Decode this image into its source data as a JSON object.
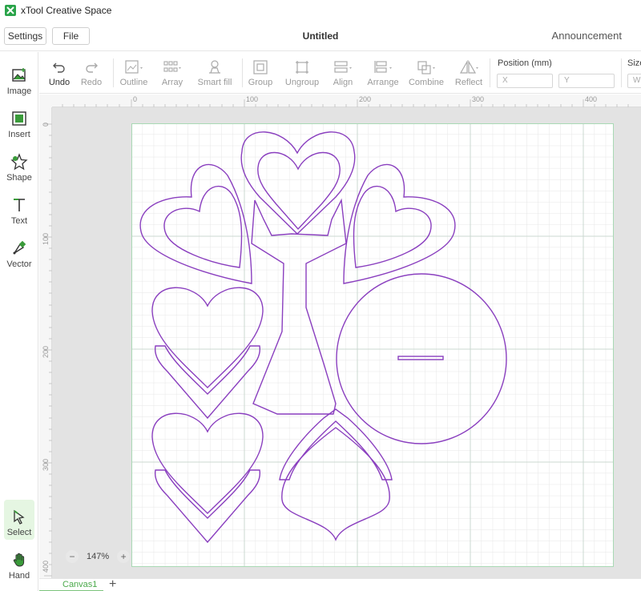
{
  "app": {
    "title": "xTool Creative Space",
    "logo_icon": "xtool-logo-icon",
    "accent": "#2aa44a"
  },
  "menubar": {
    "settings_label": "Settings",
    "file_label": "File",
    "document_title": "Untitled",
    "announcement_label": "Announcement"
  },
  "sidebar": {
    "items": [
      {
        "label": "Image",
        "icon": "image-icon"
      },
      {
        "label": "Insert",
        "icon": "insert-icon"
      },
      {
        "label": "Shape",
        "icon": "shape-icon"
      },
      {
        "label": "Text",
        "icon": "text-icon"
      },
      {
        "label": "Vector",
        "icon": "vector-icon"
      },
      {
        "label": "Select",
        "icon": "select-icon",
        "active": true
      },
      {
        "label": "Hand",
        "icon": "hand-icon"
      }
    ]
  },
  "toolbar": {
    "undo": "Undo",
    "redo": "Redo",
    "outline": "Outline",
    "array": "Array",
    "smart_fill": "Smart fill",
    "group": "Group",
    "ungroup": "Ungroup",
    "align": "Align",
    "arrange": "Arrange",
    "combine": "Combine",
    "reflect": "Reflect",
    "position_label": "Position (mm)",
    "x_placeholder": "X",
    "y_placeholder": "Y",
    "size_label": "Size",
    "w_placeholder": "W"
  },
  "ruler": {
    "top_ticks": [
      "0",
      "100",
      "200",
      "300",
      "400"
    ],
    "left_ticks": [
      "0",
      "100",
      "200",
      "300",
      "400"
    ]
  },
  "canvas": {
    "shape_stroke": "#8a3fbf",
    "grid_color": "#e4e4e4",
    "major_grid_color": "#c9d7cf",
    "board_border": "#a9d9b5"
  },
  "zoom": {
    "value": "147%",
    "minus": "−",
    "plus": "+"
  },
  "tabs": {
    "canvas_tab": "Canvas1",
    "add_tab": "+"
  }
}
